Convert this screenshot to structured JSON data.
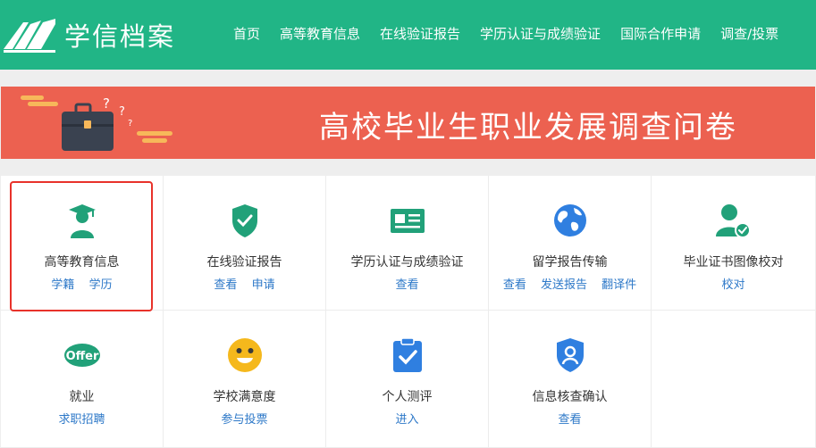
{
  "header": {
    "logo_text": "学信档案",
    "nav": [
      "首页",
      "高等教育信息",
      "在线验证报告",
      "学历认证与成绩验证",
      "国际合作申请",
      "调查/投票"
    ]
  },
  "banner": {
    "title": "高校毕业生职业发展调查问卷"
  },
  "colors": {
    "header_bg": "#21b586",
    "banner_bg": "#ec6150",
    "link": "#2d78c8",
    "highlight": "#e8322a"
  },
  "services": [
    {
      "title": "高等教育信息",
      "icon": "graduate-icon",
      "links": [
        "学籍",
        "学历"
      ]
    },
    {
      "title": "在线验证报告",
      "icon": "shield-check-icon",
      "links": [
        "查看",
        "申请"
      ]
    },
    {
      "title": "学历认证与成绩验证",
      "icon": "certificate-card-icon",
      "links": [
        "查看"
      ]
    },
    {
      "title": "留学报告传输",
      "icon": "globe-icon",
      "links": [
        "查看",
        "发送报告",
        "翻译件"
      ]
    },
    {
      "title": "毕业证书图像校对",
      "icon": "user-check-icon",
      "links": [
        "校对"
      ]
    },
    {
      "title": "就业",
      "icon": "offer-badge-icon",
      "badge": "Offer",
      "links": [
        "求职招聘"
      ]
    },
    {
      "title": "学校满意度",
      "icon": "smiley-icon",
      "links": [
        "参与投票"
      ]
    },
    {
      "title": "个人测评",
      "icon": "clipboard-check-icon",
      "links": [
        "进入"
      ]
    },
    {
      "title": "信息核查确认",
      "icon": "shield-user-icon",
      "links": [
        "查看"
      ]
    }
  ]
}
